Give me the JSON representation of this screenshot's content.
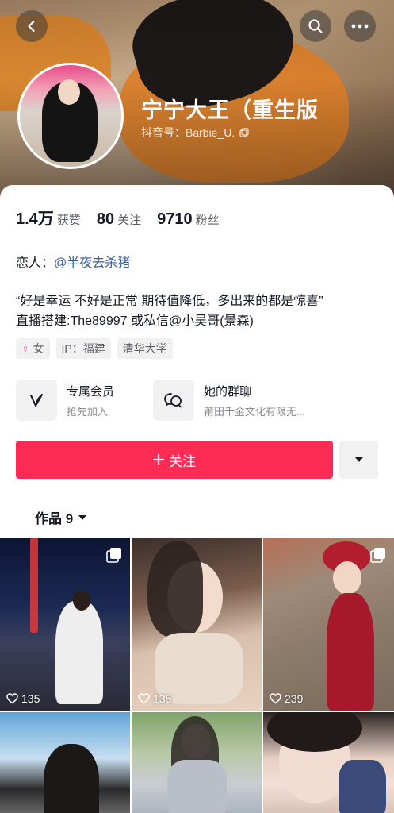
{
  "header": {
    "nickname": "宁宁大王（重生版",
    "douyin_id": "抖音号：Barbie_U."
  },
  "stats": [
    {
      "value": "1.4万",
      "label": "获赞"
    },
    {
      "value": "80",
      "label": "关注"
    },
    {
      "value": "9710",
      "label": "粉丝"
    }
  ],
  "lover": {
    "prefix": "恋人：",
    "link": "@半夜去杀猪"
  },
  "bio": {
    "line1": "“好是幸运 不好是正常   期待值降低，多出来的都是惊喜”",
    "line2": "直播搭建:The89997 或私信@小吴哥(景森)"
  },
  "tags": {
    "gender": "女",
    "ip": "IP：福建",
    "school": "清华大学"
  },
  "features": {
    "member_title": "专属会员",
    "member_sub": "抢先加入",
    "group_title": "她的群聊",
    "group_sub": "莆田千金文化有限无..."
  },
  "actions": {
    "follow_label": "关注"
  },
  "works": {
    "tab_label": "作品 9"
  },
  "grid": [
    {
      "likes": "135"
    },
    {
      "likes": "135"
    },
    {
      "likes": "239"
    }
  ],
  "colors": {
    "accent": "#fe2c55",
    "link": "#3b5b9a"
  }
}
